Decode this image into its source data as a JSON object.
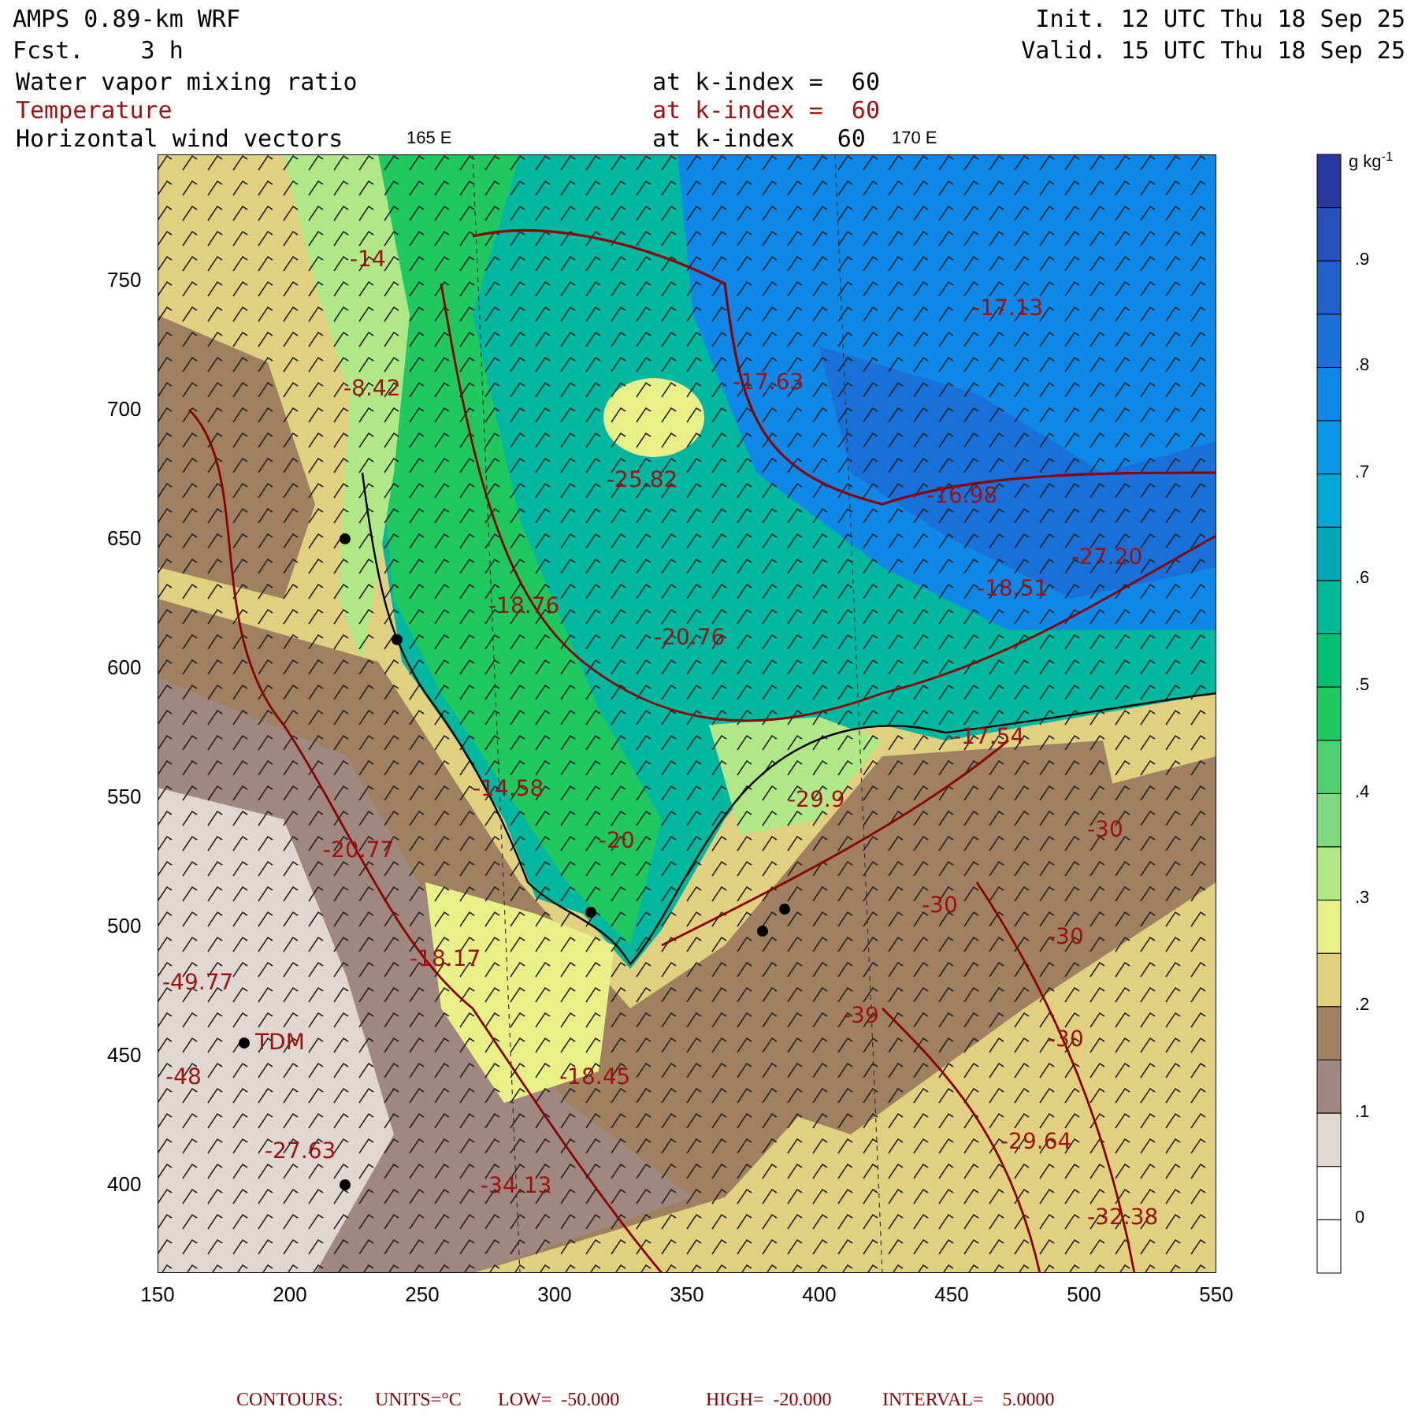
{
  "header": {
    "model": "AMPS 0.89-km WRF",
    "forecast": "Fcst.    3 h",
    "init": "Init. 12 UTC Thu 18 Sep 25",
    "valid": "Valid. 15 UTC Thu 18 Sep 25"
  },
  "fields": [
    {
      "name": "Water vapor mixing ratio",
      "level": "at k-index =  60",
      "kind": "shaded"
    },
    {
      "name": "Temperature",
      "level": "at k-index =  60",
      "kind": "contour"
    },
    {
      "name": "Horizontal wind vectors",
      "level": "at k-index   60",
      "kind": "vector"
    }
  ],
  "longitude_labels": [
    "165 E",
    "170 E"
  ],
  "x_ticks": [
    "150",
    "200",
    "250",
    "300",
    "350",
    "400",
    "450",
    "500",
    "550"
  ],
  "y_ticks": [
    "750",
    "700",
    "650",
    "600",
    "550",
    "500",
    "450",
    "400"
  ],
  "map_labels": [
    "-25.82",
    "-20.76",
    "-18.76",
    "-17.63",
    "-17.13",
    "-16.98",
    "-18.51",
    "-27.20",
    "-17.54",
    "-29.9",
    "-20",
    "-14.58",
    "-20.77",
    "-18.17",
    "-18.45",
    "-34.13",
    "-27.63",
    "-49.77",
    "-48",
    "-30",
    "-30",
    "-30",
    "-30",
    "-29.64",
    "-32.38",
    "-39",
    "-14",
    "-8.42",
    "TDM"
  ],
  "colorbar": {
    "units": "g kg$^{-1}$",
    "cells": [
      {
        "color": "#2838a0"
      },
      {
        "color": "#2850b8"
      },
      {
        "color": "#2060c8"
      },
      {
        "color": "#1870d8"
      },
      {
        "color": "#1088e8"
      },
      {
        "color": "#0898e8"
      },
      {
        "color": "#00a8d8"
      },
      {
        "color": "#00a8b8"
      },
      {
        "color": "#00b898"
      },
      {
        "color": "#00c070"
      },
      {
        "color": "#20c860"
      },
      {
        "color": "#50d070"
      },
      {
        "color": "#80d880"
      },
      {
        "color": "#b0e888"
      },
      {
        "color": "#e8f088"
      },
      {
        "color": "#e0d080"
      },
      {
        "color": "#a08060"
      },
      {
        "color": "#a08880"
      },
      {
        "color": "#e0d8d0"
      },
      {
        "color": "#ffffff"
      },
      {
        "color": "#ffffff"
      }
    ],
    "labels": [
      ".9",
      ".8",
      ".7",
      ".6",
      ".5",
      ".4",
      ".3",
      ".2",
      ".1",
      "0"
    ]
  },
  "footer": {
    "contours": "CONTOURS:",
    "units": "UNITS=°C",
    "low": "LOW=  -50.000",
    "high": "HIGH=  -20.000",
    "interval": "INTERVAL=    5.0000"
  }
}
